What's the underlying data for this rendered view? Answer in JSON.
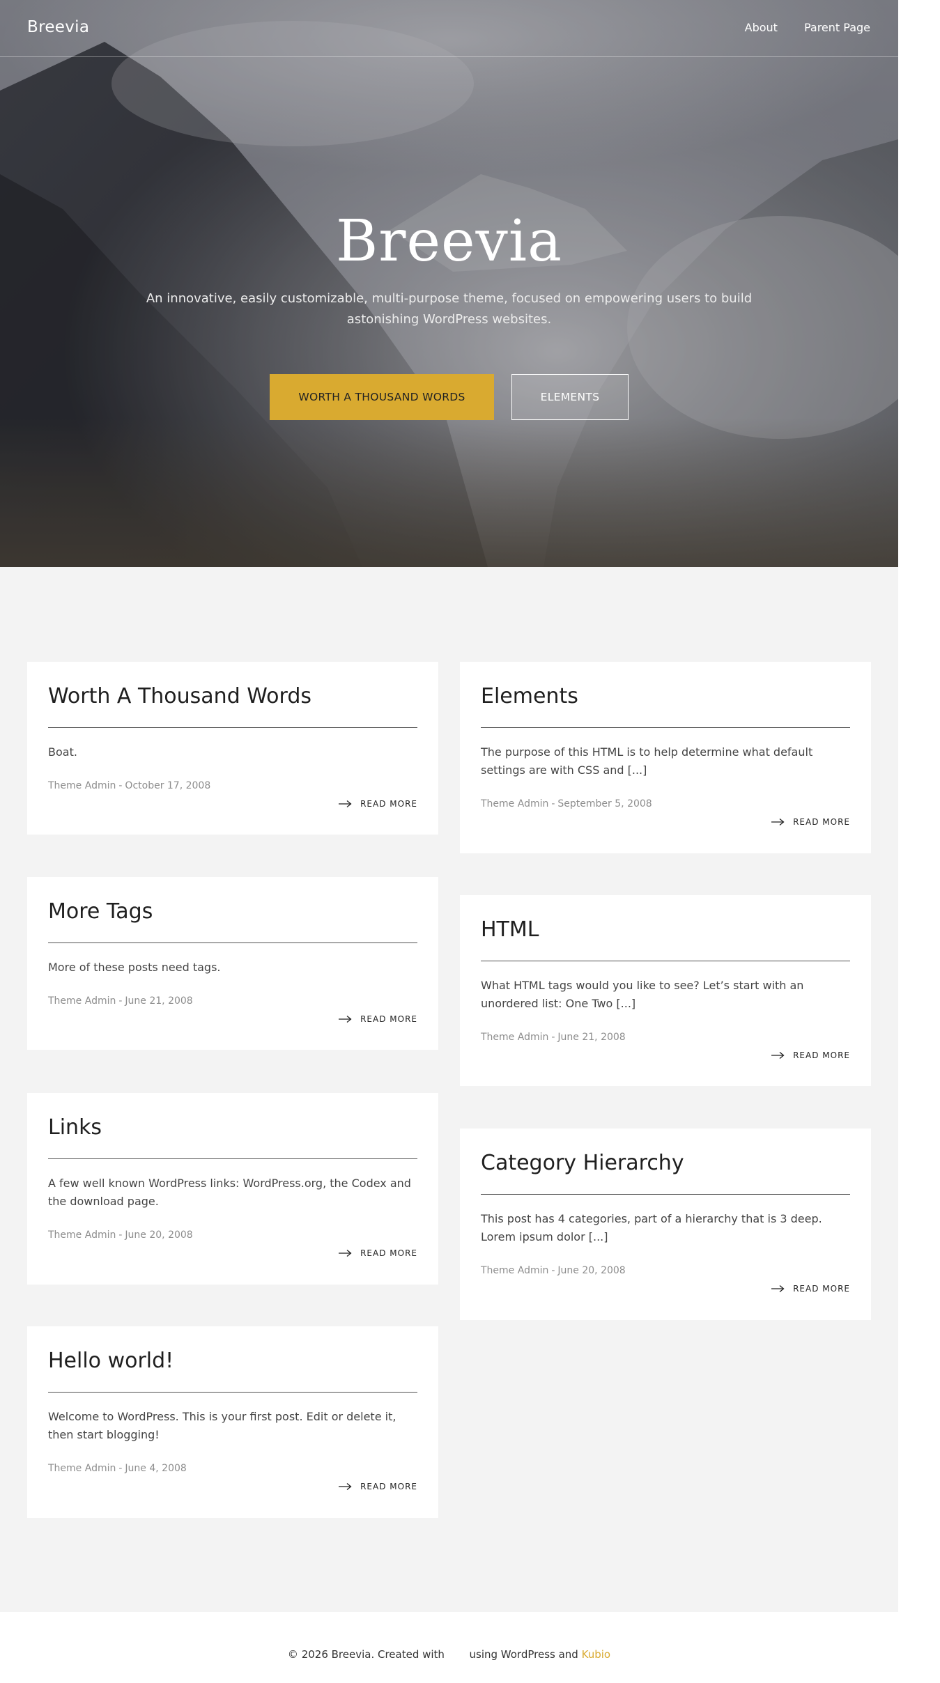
{
  "header": {
    "site_name": "Breevia",
    "nav": [
      {
        "label": "About"
      },
      {
        "label": "Parent Page"
      }
    ]
  },
  "hero": {
    "title": "Breevia",
    "subtitle": "An innovative, easily customizable, multi-purpose theme, focused on empowering users to build astonishing WordPress websites.",
    "primary_button": "WORTH A THOUSAND WORDS",
    "secondary_button": "ELEMENTS"
  },
  "posts": [
    {
      "title": "Worth A Thousand Words",
      "excerpt": "Boat.",
      "author": "Theme Admin",
      "date": "October 17, 2008",
      "read_more": "READ MORE"
    },
    {
      "title": "Elements",
      "excerpt": "The purpose of this HTML is to help determine what default settings are with CSS and [...]",
      "author": "Theme Admin",
      "date": "September 5, 2008",
      "read_more": "READ MORE"
    },
    {
      "title": "More Tags",
      "excerpt": "More of these posts need tags.",
      "author": "Theme Admin",
      "date": "June 21, 2008",
      "read_more": "READ MORE"
    },
    {
      "title": "HTML",
      "excerpt": "What HTML tags would you like to see? Let’s start with an unordered list: One Two [...]",
      "author": "Theme Admin",
      "date": "June 21, 2008",
      "read_more": "READ MORE"
    },
    {
      "title": "Links",
      "excerpt": "A few well known WordPress links: WordPress.org, the Codex and the download page.",
      "author": "Theme Admin",
      "date": "June 20, 2008",
      "read_more": "READ MORE"
    },
    {
      "title": "Category Hierarchy",
      "excerpt": "This post has 4 categories, part of a hierarchy that is 3 deep. Lorem ipsum dolor [...]",
      "author": "Theme Admin",
      "date": "June 20, 2008",
      "read_more": "READ MORE"
    },
    {
      "title": "Hello world!",
      "excerpt": "Welcome to WordPress. This is your first post. Edit or delete it, then start blogging!",
      "author": "Theme Admin",
      "date": "June 4, 2008",
      "read_more": "READ MORE"
    }
  ],
  "footer": {
    "copyright": "© 2026 Breevia. Created with",
    "using": "using WordPress and",
    "kubio": "Kubio"
  },
  "colors": {
    "accent": "#d9aa30",
    "page_background": "#f3f3f3",
    "card_background": "#ffffff",
    "heading_text": "#1f1f1f",
    "meta_text": "#8d8d8d"
  },
  "icons": {
    "read_more": "arrow-right-icon"
  }
}
